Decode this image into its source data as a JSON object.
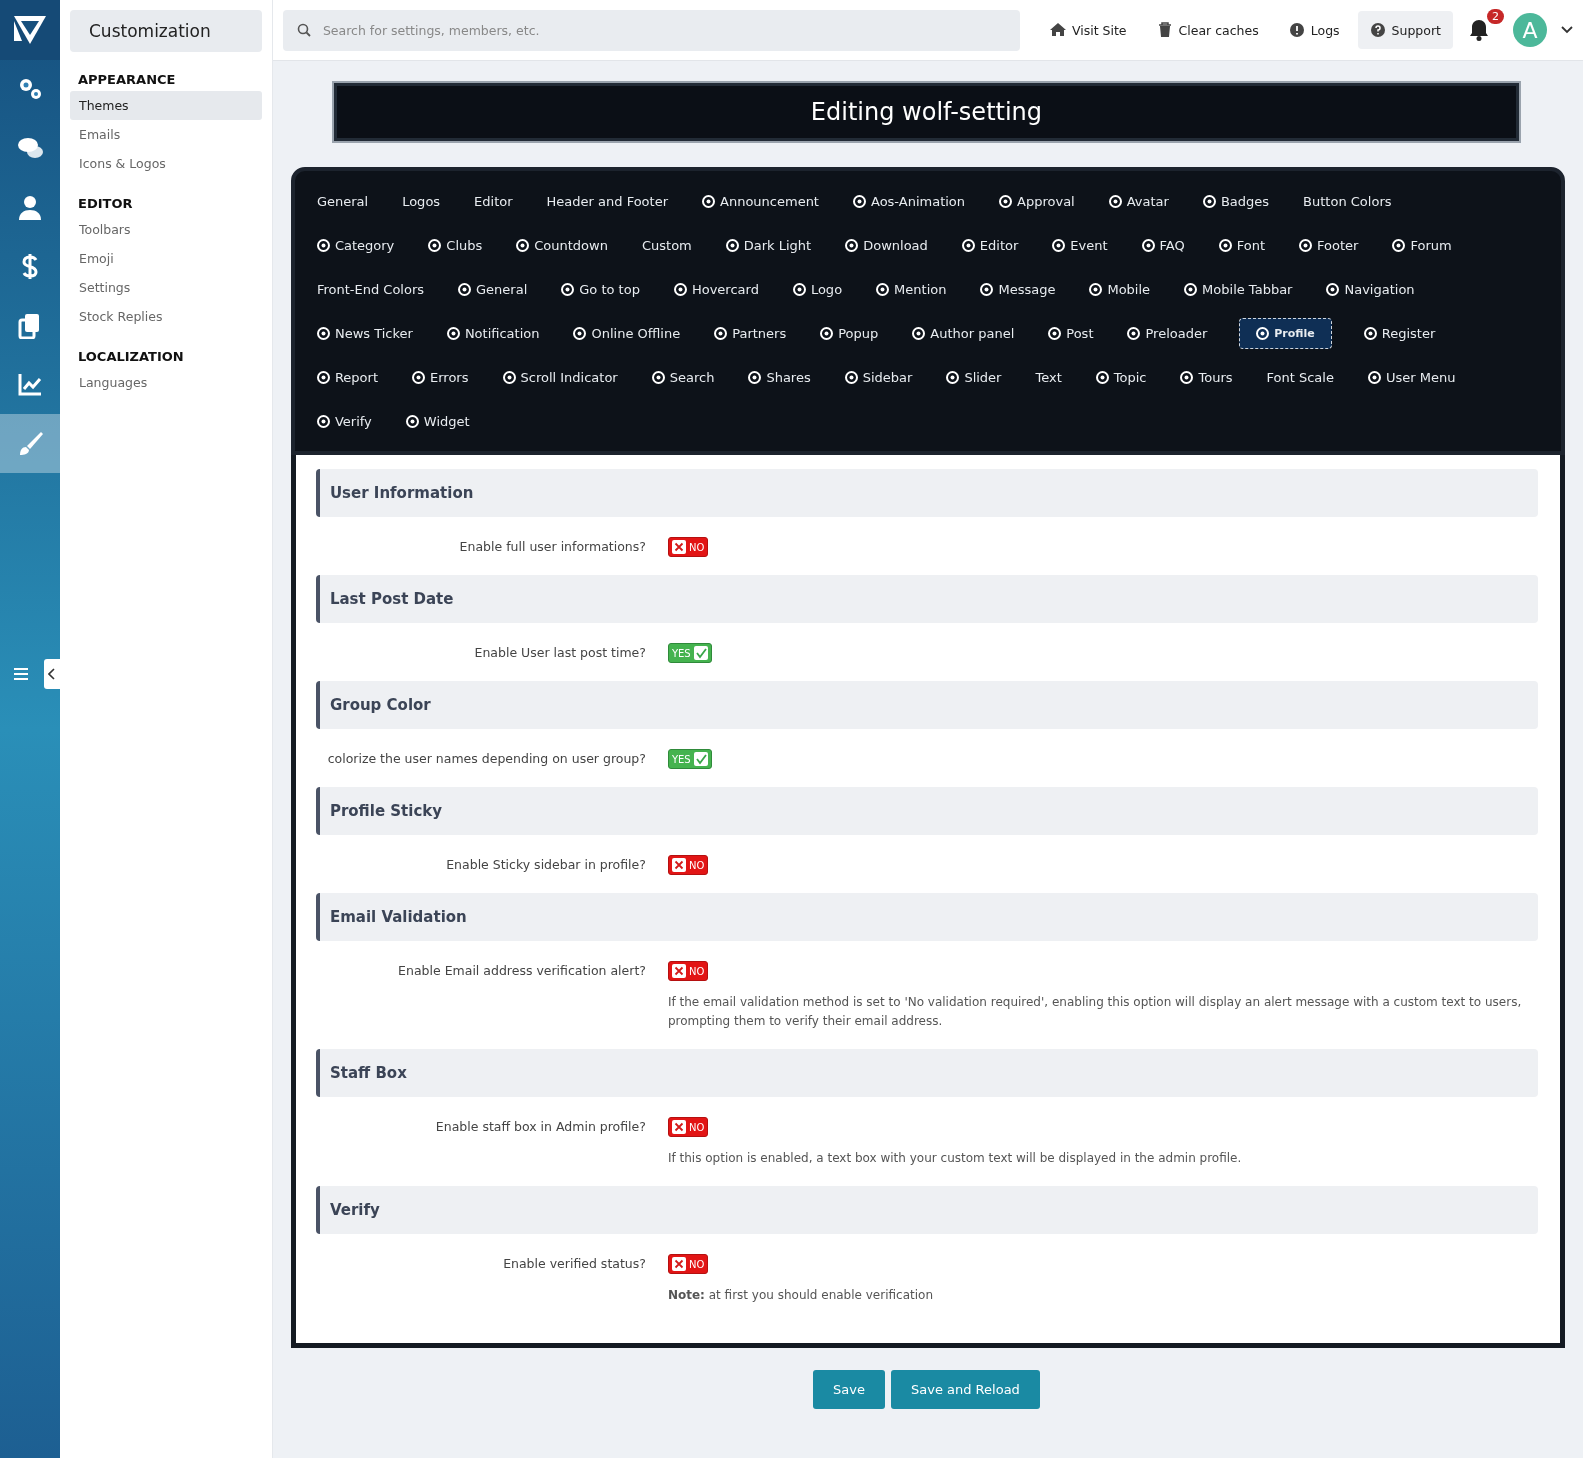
{
  "rail": {
    "items": [
      {
        "selected": false
      },
      {
        "selected": false
      },
      {
        "selected": false
      },
      {
        "selected": false
      },
      {
        "selected": false
      },
      {
        "selected": false
      },
      {
        "selected": true
      }
    ]
  },
  "sidebar": {
    "title": "Customization",
    "groups": [
      {
        "heading": "APPEARANCE",
        "items": [
          {
            "label": "Themes",
            "selected": true
          },
          {
            "label": "Emails",
            "selected": false
          },
          {
            "label": "Icons & Logos",
            "selected": false
          }
        ]
      },
      {
        "heading": "EDITOR",
        "items": [
          {
            "label": "Toolbars",
            "selected": false
          },
          {
            "label": "Emoji",
            "selected": false
          },
          {
            "label": "Settings",
            "selected": false
          },
          {
            "label": "Stock Replies",
            "selected": false
          }
        ]
      },
      {
        "heading": "LOCALIZATION",
        "items": [
          {
            "label": "Languages",
            "selected": false
          }
        ]
      }
    ]
  },
  "topbar": {
    "search": {
      "placeholder": "Search for settings, members, etc."
    },
    "links": [
      {
        "label": "Visit Site",
        "selected": false
      },
      {
        "label": "Clear caches",
        "selected": false
      },
      {
        "label": "Logs",
        "selected": false
      },
      {
        "label": "Support",
        "selected": true
      }
    ],
    "notifications": "2",
    "avatar": "A"
  },
  "title": "Editing wolf-setting",
  "tab_rows": [
    [
      {
        "label": "General",
        "kind": "plain",
        "selected": false
      },
      {
        "label": "Logos",
        "kind": "plain",
        "selected": false
      },
      {
        "label": "Editor",
        "kind": "plain",
        "selected": false
      },
      {
        "label": "Header and Footer",
        "kind": "plain",
        "selected": false
      },
      {
        "label": "Announcement",
        "kind": "icon",
        "selected": false
      },
      {
        "label": "Aos-Animation",
        "kind": "icon",
        "selected": false
      },
      {
        "label": "Approval",
        "kind": "icon",
        "selected": false
      },
      {
        "label": "Avatar",
        "kind": "icon",
        "selected": false
      },
      {
        "label": "Badges",
        "kind": "icon",
        "selected": false
      },
      {
        "label": "Button Colors",
        "kind": "plain",
        "selected": false
      }
    ],
    [
      {
        "label": "Category",
        "kind": "icon",
        "selected": false
      },
      {
        "label": "Clubs",
        "kind": "icon",
        "selected": false
      },
      {
        "label": "Countdown",
        "kind": "icon",
        "selected": false
      },
      {
        "label": "Custom",
        "kind": "plain",
        "selected": false
      },
      {
        "label": "Dark Light",
        "kind": "icon",
        "selected": false
      },
      {
        "label": "Download",
        "kind": "icon",
        "selected": false
      },
      {
        "label": "Editor",
        "kind": "icon",
        "selected": false
      },
      {
        "label": "Event",
        "kind": "icon",
        "selected": false
      },
      {
        "label": "FAQ",
        "kind": "icon",
        "selected": false
      },
      {
        "label": "Font",
        "kind": "icon",
        "selected": false
      },
      {
        "label": "Footer",
        "kind": "icon",
        "selected": false
      },
      {
        "label": "Forum",
        "kind": "icon",
        "selected": false
      }
    ],
    [
      {
        "label": "Front-End Colors",
        "kind": "plain",
        "selected": false
      },
      {
        "label": "General",
        "kind": "icon",
        "selected": false
      },
      {
        "label": "Go to top",
        "kind": "icon",
        "selected": false
      },
      {
        "label": "Hovercard",
        "kind": "icon",
        "selected": false
      },
      {
        "label": "Logo",
        "kind": "icon",
        "selected": false
      },
      {
        "label": "Mention",
        "kind": "icon",
        "selected": false
      },
      {
        "label": "Message",
        "kind": "icon",
        "selected": false
      },
      {
        "label": "Mobile",
        "kind": "icon",
        "selected": false
      },
      {
        "label": "Mobile Tabbar",
        "kind": "icon",
        "selected": false
      },
      {
        "label": "Navigation",
        "kind": "icon",
        "selected": false
      }
    ],
    [
      {
        "label": "News Ticker",
        "kind": "icon",
        "selected": false
      },
      {
        "label": "Notification",
        "kind": "icon",
        "selected": false
      },
      {
        "label": "Online Offline",
        "kind": "icon",
        "selected": false
      },
      {
        "label": "Partners",
        "kind": "icon",
        "selected": false
      },
      {
        "label": "Popup",
        "kind": "icon",
        "selected": false
      },
      {
        "label": "Author panel",
        "kind": "icon",
        "selected": false
      },
      {
        "label": "Post",
        "kind": "icon",
        "selected": false
      },
      {
        "label": "Preloader",
        "kind": "icon",
        "selected": false
      },
      {
        "label": "Profile",
        "kind": "icon",
        "selected": true
      },
      {
        "label": "Register",
        "kind": "icon",
        "selected": false
      }
    ],
    [
      {
        "label": "Report",
        "kind": "icon",
        "selected": false
      },
      {
        "label": "Errors",
        "kind": "icon",
        "selected": false
      },
      {
        "label": "Scroll Indicator",
        "kind": "icon",
        "selected": false
      },
      {
        "label": "Search",
        "kind": "icon",
        "selected": false
      },
      {
        "label": "Shares",
        "kind": "icon",
        "selected": false
      },
      {
        "label": "Sidebar",
        "kind": "icon",
        "selected": false
      },
      {
        "label": "Slider",
        "kind": "icon",
        "selected": false
      },
      {
        "label": "Text",
        "kind": "plain",
        "selected": false
      },
      {
        "label": "Topic",
        "kind": "icon",
        "selected": false
      },
      {
        "label": "Tours",
        "kind": "icon",
        "selected": false
      },
      {
        "label": "Font Scale",
        "kind": "plain",
        "selected": false
      },
      {
        "label": "User Menu",
        "kind": "icon",
        "selected": false
      }
    ],
    [
      {
        "label": "Verify",
        "kind": "icon",
        "selected": false
      },
      {
        "label": "Widget",
        "kind": "icon",
        "selected": false
      }
    ]
  ],
  "sections": [
    {
      "heading": "User Information",
      "label": "Enable full user informations?",
      "on": false,
      "toggle": "NO"
    },
    {
      "heading": "Last Post Date",
      "label": "Enable User last post time?",
      "on": true,
      "toggle": "YES"
    },
    {
      "heading": "Group Color",
      "label": "colorize the user names depending on user group?",
      "on": true,
      "toggle": "YES"
    },
    {
      "heading": "Profile Sticky",
      "label": "Enable Sticky sidebar in profile?",
      "on": false,
      "toggle": "NO"
    },
    {
      "heading": "Email Validation",
      "label": "Enable Email address verification alert?",
      "on": false,
      "toggle": "NO",
      "explain": "If the email validation method is set to 'No validation required', enabling this option will display an alert message with a custom text to users, prompting them to verify their email address."
    },
    {
      "heading": "Staff Box",
      "label": "Enable staff box in Admin profile?",
      "on": false,
      "toggle": "NO",
      "explain": "If this option is enabled, a text box with your custom text will be displayed in the admin profile."
    },
    {
      "heading": "Verify",
      "label": "Enable verified status?",
      "on": false,
      "toggle": "NO",
      "explain": "**Note:** at first you should enable verification"
    }
  ],
  "buttons": [
    "Save",
    "Save and Reload"
  ]
}
